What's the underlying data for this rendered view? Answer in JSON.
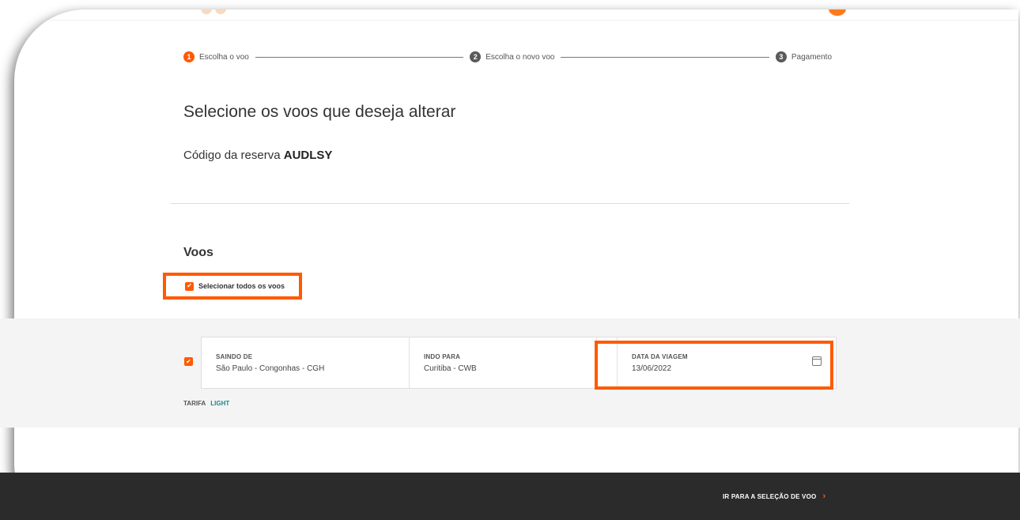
{
  "stepper": {
    "steps": [
      {
        "number": "1",
        "label": "Escolha o voo"
      },
      {
        "number": "2",
        "label": "Escolha o novo voo"
      },
      {
        "number": "3",
        "label": "Pagamento"
      }
    ]
  },
  "main": {
    "title": "Selecione os voos que deseja alterar",
    "booking_label": "Código da reserva",
    "booking_code": "AUDLSY",
    "flights_title": "Voos",
    "select_all_label": "Selecionar todos os voos"
  },
  "flight": {
    "origin_label": "SAINDO DE",
    "origin_value": "São Paulo  -  Congonhas - CGH",
    "dest_label": "INDO PARA",
    "dest_value": "Curitiba - CWB",
    "date_label": "DATA DA VIAGEM",
    "date_value": "13/06/2022",
    "fare_label": "TARIFA",
    "fare_value": "LIGHT"
  },
  "footer": {
    "next_label": "IR PARA A SELEÇÃO DE VOO",
    "next_icon": "chevron-right-icon"
  },
  "colors": {
    "accent": "#ff5a00",
    "footer_bg": "#2b2b2b",
    "fare_value": "#1b8a8a"
  }
}
